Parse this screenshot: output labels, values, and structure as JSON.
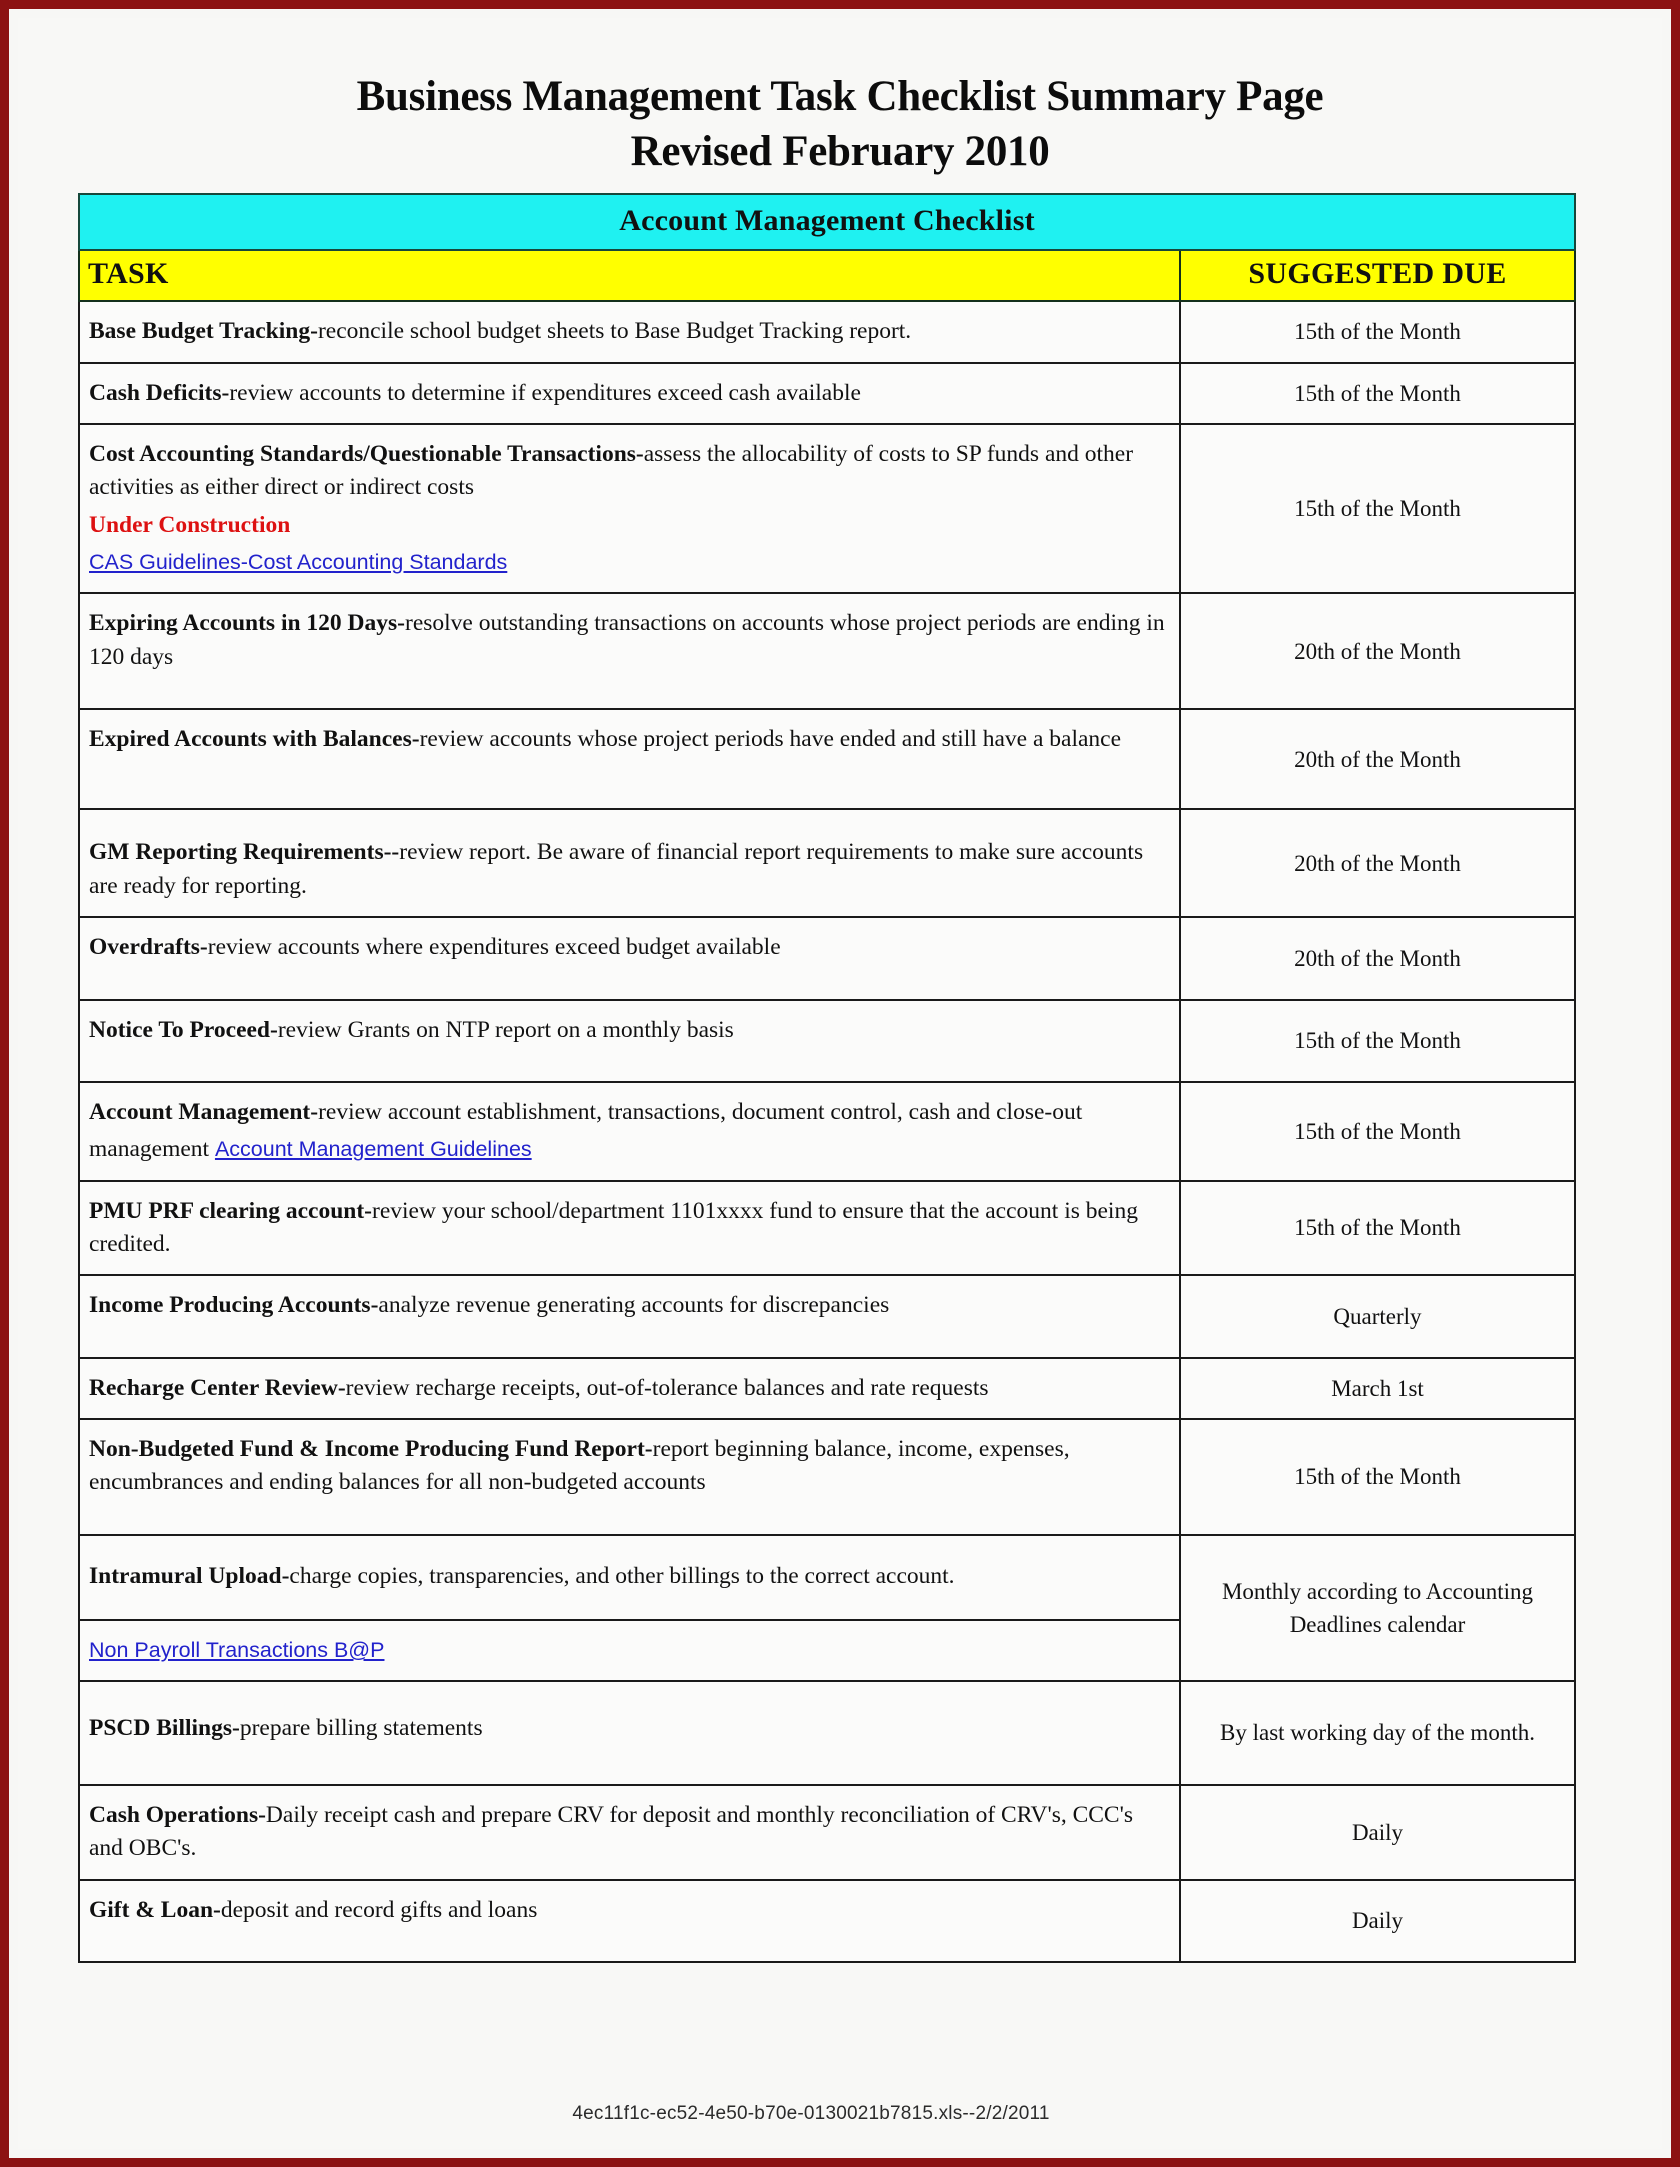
{
  "document": {
    "title_line1": "Business Management Task Checklist Summary Page",
    "title_line2": "Revised February 2010",
    "footer": "4ec11f1c-ec52-4e50-b70e-0130021b7815.xls--2/2/2011"
  },
  "colors": {
    "banner_cyan": "#1ff1f1",
    "banner_yellow": "#ffff00",
    "link_blue": "#2222cc",
    "warning_red": "#dd1111",
    "frame_red": "#8c1212"
  },
  "table": {
    "section_title": "Account Management Checklist",
    "columns": {
      "task": "TASK",
      "due": "SUGGESTED DUE"
    },
    "rows": [
      {
        "term": "Base Budget Tracking-",
        "desc": "reconcile school budget sheets to Base Budget Tracking report.",
        "due": "15th of the Month"
      },
      {
        "term": "Cash Deficits-",
        "desc": "review accounts to determine if expenditures exceed cash available",
        "due": "15th of the Month"
      },
      {
        "term": "Cost Accounting Standards/Questionable Transactions-",
        "desc": "assess the allocability of costs to SP funds and other activities as either direct or indirect costs",
        "note": "Under Construction",
        "link": "CAS Guidelines-Cost Accounting Standards",
        "due": "15th of the Month"
      },
      {
        "term": "Expiring Accounts in 120 Days-",
        "desc": "resolve outstanding transactions on accounts whose project periods are ending in 120 days",
        "due": "20th of the Month"
      },
      {
        "term": "Expired Accounts with Balances-",
        "desc": "review accounts whose project periods have ended and still have a balance",
        "due": "20th of the Month"
      },
      {
        "term": "GM Reporting Requirements--",
        "desc": "review report.  Be aware of financial report requirements to make sure accounts are ready for reporting.",
        "due": "20th of the Month"
      },
      {
        "term": "Overdrafts-",
        "desc": "review accounts where expenditures exceed budget available",
        "due": "20th of the Month"
      },
      {
        "term": "Notice To Proceed-",
        "desc": "review Grants on NTP report on a monthly basis",
        "due": "15th of the Month"
      },
      {
        "term": "Account Management-",
        "desc": "review account establishment, transactions, document control, cash and close-out management",
        "link": "Account Management Guidelines",
        "due": "15th of the Month"
      },
      {
        "term": "PMU PRF clearing account-",
        "desc": "review your school/department 1101xxxx fund to ensure that the account is being credited.",
        "due": "15th of the Month"
      },
      {
        "term": "Income Producing Accounts-",
        "desc": "analyze revenue generating accounts for discrepancies",
        "due": "Quarterly"
      },
      {
        "term": "Recharge Center Review-",
        "desc": "review recharge receipts, out-of-tolerance balances and rate requests",
        "due": "March 1st"
      },
      {
        "term": "Non-Budgeted Fund & Income Producing Fund Report-",
        "desc": "report beginning balance, income, expenses, encumbrances and ending balances for all non-budgeted accounts",
        "due": "15th of the Month"
      },
      {
        "term": "Intramural Upload-",
        "desc": "charge copies, transparencies, and other billings to the correct account.",
        "link": "Non Payroll Transactions B@P",
        "due": "Monthly according to Accounting Deadlines calendar"
      },
      {
        "term": "PSCD Billings-",
        "desc": "prepare billing statements",
        "due": "By last working day of the month."
      },
      {
        "term": "Cash Operations-",
        "desc": "Daily receipt cash and prepare CRV for deposit and monthly reconciliation of CRV's, CCC's  and OBC's.",
        "due": "Daily"
      },
      {
        "term": "Gift & Loan-",
        "desc": "deposit and record gifts and loans",
        "due": "Daily"
      }
    ]
  }
}
